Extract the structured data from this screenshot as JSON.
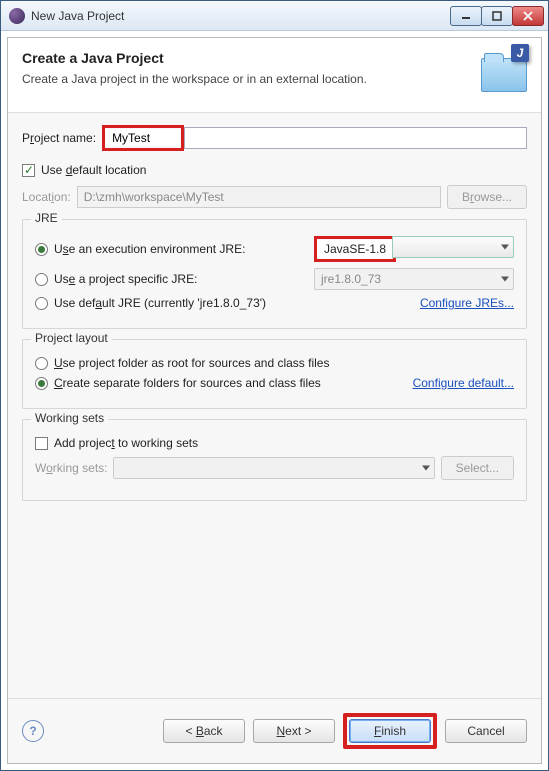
{
  "window": {
    "title": "New Java Project"
  },
  "header": {
    "title": "Create a Java Project",
    "subtitle": "Create a Java project in the workspace or in an external location."
  },
  "projectName": {
    "label_pre": "P",
    "label_u": "r",
    "label_post": "oject name:",
    "value": "MyTest"
  },
  "defaultLocation": {
    "label_pre": "Use ",
    "label_u": "d",
    "label_post": "efault location",
    "checked": true
  },
  "location": {
    "label_pre": "Locat",
    "label_u": "i",
    "label_post": "on:",
    "value": "D:\\zmh\\workspace\\MyTest",
    "browse_pre": "B",
    "browse_u": "r",
    "browse_post": "owse..."
  },
  "jre": {
    "group": "JRE",
    "exec": {
      "label_pre": "U",
      "label_u": "s",
      "label_post": "e an execution environment JRE:",
      "selected": true,
      "value": "JavaSE-1.8"
    },
    "specific": {
      "label_pre": "Us",
      "label_u": "e",
      "label_post": " a project specific JRE:",
      "selected": false,
      "value": "jre1.8.0_73"
    },
    "default": {
      "label_pre": "Use def",
      "label_u": "a",
      "label_post": "ult JRE (currently 'jre1.8.0_73')",
      "selected": false
    },
    "configure": "Configure JREs..."
  },
  "layout": {
    "group": "Project layout",
    "root": {
      "label_pre": "",
      "label_u": "U",
      "label_post": "se project folder as root for sources and class files",
      "selected": false
    },
    "separate": {
      "label_pre": "",
      "label_u": "C",
      "label_post": "reate separate folders for sources and class files",
      "selected": true
    },
    "configure": "Configure default..."
  },
  "workingSets": {
    "group": "Working sets",
    "add": {
      "label_pre": "Add projec",
      "label_u": "t",
      "label_post": " to working sets",
      "checked": false
    },
    "label_pre": "W",
    "label_u": "o",
    "label_post": "rking sets:",
    "value": "",
    "selectBtn": "Select..."
  },
  "footer": {
    "back_pre": "< ",
    "back_u": "B",
    "back_post": "ack",
    "next_pre": "",
    "next_u": "N",
    "next_post": "ext >",
    "finish_pre": "",
    "finish_u": "F",
    "finish_post": "inish",
    "cancel": "Cancel"
  }
}
